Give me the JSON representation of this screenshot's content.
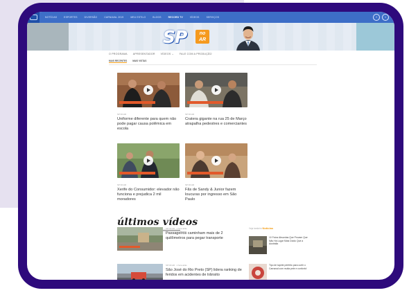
{
  "nav": {
    "links": [
      "NOTÍCIAS",
      "ESPORTES",
      "DIVERSÃO",
      "CARNAVAL 2019",
      "MEU ESTILO",
      "BLOGS",
      "RECORD TV",
      "VÍDEOS",
      "SERVIÇOS"
    ],
    "active_index": 6,
    "social": [
      "f",
      "t"
    ]
  },
  "banner": {
    "logo_text": "SP",
    "logo_badge_line1": "no",
    "logo_badge_line2": "AR"
  },
  "subnav": [
    "O PROGRAMA",
    "APRESENTADOR",
    "VÍDEOS ⌄",
    "FALE COM A PRODUÇÃO"
  ],
  "tabs": [
    "MAIS RECENTES",
    "MAIS VISTAS"
  ],
  "featured": [
    {
      "date": "SP NO AR",
      "title": "Uniforme diferente para quem não pode pagar causa polêmica em escola"
    },
    {
      "date": "SP NO AR",
      "title": "Cratera gigante na rua 25 de Março atrapalha pedestres e comerciantes"
    },
    {
      "date": "SP NO AR",
      "title": "Xerife do Consumidor: elevador não funciona e prejudica 2 mil moradores"
    },
    {
      "date": "SP NO AR",
      "title": "Fãs de Sandy & Junior fazem loucuras por ingresso em São Paulo"
    }
  ],
  "latest_section": {
    "title": "últimos vídeos"
  },
  "latest": [
    {
      "meta": "SP NO AR · 1 hora atrás",
      "title": "Passageiros caminham mais de 2 quilômetros para pegar transporte"
    },
    {
      "meta": "SP NO AR · 1 hora atrás",
      "title": "São José do Rio Preto (SP) lidera ranking de feridos em acidentes de trânsito"
    }
  ],
  "sidebar": {
    "prefix": "Veja também",
    "label": "Notícias",
    "items": [
      {
        "title": "10 Fotos Absurdas Que Provam Que Não Há Lugar Mais Doido Que a Austrália"
      },
      {
        "title": "Tipo de tapete perfeito para curtir o Carnaval com muita pele e conforto!"
      }
    ]
  },
  "colors": {
    "frame": "#2e0a7c",
    "nav": "#3d6ec7",
    "accent": "#f39c12"
  }
}
